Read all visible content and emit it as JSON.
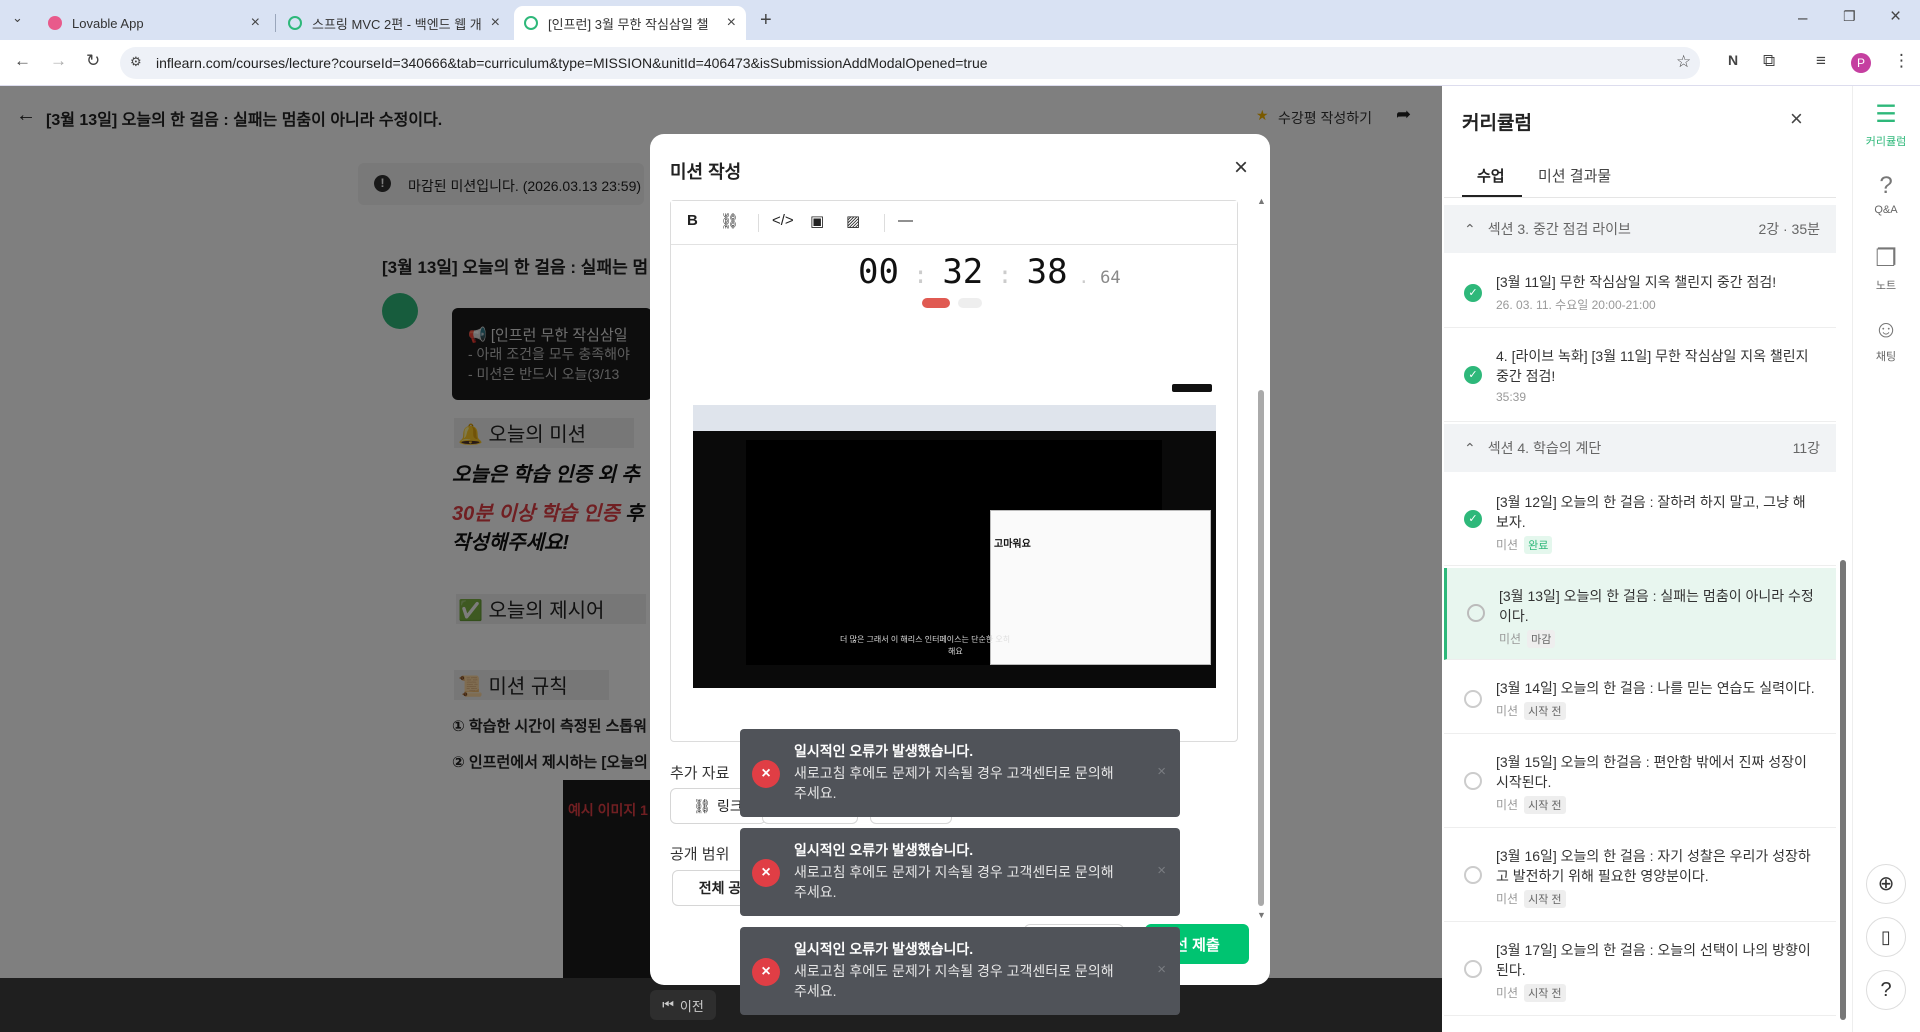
{
  "browser": {
    "tabs": [
      {
        "title": "Lovable App",
        "color": "#e85a8b",
        "active": false
      },
      {
        "title": "스프링 MVC 2편 - 백엔드 웹 개",
        "color": "#2eb87a",
        "active": false
      },
      {
        "title": "[인프런] 3월 무한 작심삼일 챌",
        "color": "#2eb87a",
        "active": true
      }
    ],
    "url": "inflearn.com/courses/lecture?courseId=340666&tab=curriculum&type=MISSION&unitId=406473&isSubmissionAddModalOpened=true",
    "profile_initial": "P"
  },
  "header": {
    "title": "[3월 13일] 오늘의 한 걸음 : 실패는 멈춤이 아니라 수정이다.",
    "review_label": "수강평 작성하기"
  },
  "lecture": {
    "closed_notice": "마감된 미션입니다. (2026.03.13 23:59)",
    "post_title": "[3월 13일] 오늘의 한 걸음 : 실패는 멈",
    "quote_line1": "📢 [인프런 무한 작심삼일 ",
    "quote_line2": "- 아래 조건을 모두 충족해야",
    "quote_line3": "- 미션은 반드시 오늘(3/13",
    "h_mission": "🔔 오늘의 미션",
    "p1": "오늘은 학습 인증 외 추",
    "p2_red": "30분 이상 학습 인증",
    "p2_rest": " 후",
    "p3": "작성해주세요!",
    "h_suggest": "✅ 오늘의 제시어",
    "h_rules": "📜 미션 규칙",
    "rule1": "① 학습한 시간이 측정된 스톱워",
    "rule2": "② 인프런에서 제시하는 [오늘의",
    "example_label": "예시 이미지 1",
    "prev_label": "이전"
  },
  "modal": {
    "title": "미션 작성",
    "timer": {
      "h": "00",
      "m": "32",
      "s": "38",
      "ms": "64"
    },
    "screenshot_text": "고마워요",
    "screenshot_caption": "더 많은 그래서 이 해리스 인터페이스는 단순한 오히",
    "screenshot_caption2": "해요",
    "extra_label": "추가 자료",
    "link_btn": "링크",
    "visibility_label": "공개 범위",
    "visibility_all": "전체 공",
    "submit_label": "선 제출"
  },
  "toasts": [
    {
      "title": "일시적인 오류가 발생했습니다.",
      "message": "새로고침 후에도 문제가 지속될 경우 고객센터로 문의해주세요."
    },
    {
      "title": "일시적인 오류가 발생했습니다.",
      "message": "새로고침 후에도 문제가 지속될 경우 고객센터로 문의해주세요."
    },
    {
      "title": "일시적인 오류가 발생했습니다.",
      "message": "새로고침 후에도 문제가 지속될 경우 고객센터로 문의해주세요."
    }
  ],
  "curriculum": {
    "title": "커리큘럼",
    "tab_lessons": "수업",
    "tab_results": "미션 결과물",
    "sec3": {
      "label": "섹션 3. 중간 점검 라이브",
      "count": "2강 · 35분"
    },
    "sec3_items": [
      {
        "title": "[3월 11일] 무한 작심삼일 지옥 챌린지 중간 점검!",
        "meta": "26. 03. 11. 수요일 20:00-21:00"
      },
      {
        "title": "4. [라이브 녹화] [3월 11일] 무한 작심삼일 지옥 챌린지 중간 점검!",
        "meta": "35:39"
      }
    ],
    "sec4": {
      "label": "섹션 4. 학습의 계단",
      "count": "11강"
    },
    "sec4_items": [
      {
        "title": "[3월 12일] 오늘의 한 걸음 : 잘하려 하지 말고, 그냥 해보자.",
        "type": "미션",
        "badge": "완료"
      },
      {
        "title": "[3월 13일] 오늘의 한 걸음 : 실패는 멈춤이 아니라 수정이다.",
        "type": "미션",
        "badge": "마감"
      },
      {
        "title": "[3월 14일] 오늘의 한 걸음 : 나를 믿는 연습도 실력이다.",
        "type": "미션",
        "badge": "시작 전"
      },
      {
        "title": "[3월 15일] 오늘의 한걸음 : 편안함 밖에서 진짜 성장이 시작된다.",
        "type": "미션",
        "badge": "시작 전"
      },
      {
        "title": "[3월 16일] 오늘의 한 걸음 : 자기 성찰은 우리가 성장하고 발전하기 위해 필요한 영양분이다.",
        "type": "미션",
        "badge": "시작 전"
      },
      {
        "title": "[3월 17일] 오늘의 한 걸음 : 오늘의 선택이 나의 방향이 된다.",
        "type": "미션",
        "badge": "시작 전"
      }
    ]
  },
  "rail": {
    "curriculum": "커리큘럼",
    "qna": "Q&A",
    "note": "노트",
    "chat": "채팅"
  },
  "colors": {
    "accent": "#00c471",
    "error": "#e03e45",
    "red_text": "#e03e45"
  }
}
